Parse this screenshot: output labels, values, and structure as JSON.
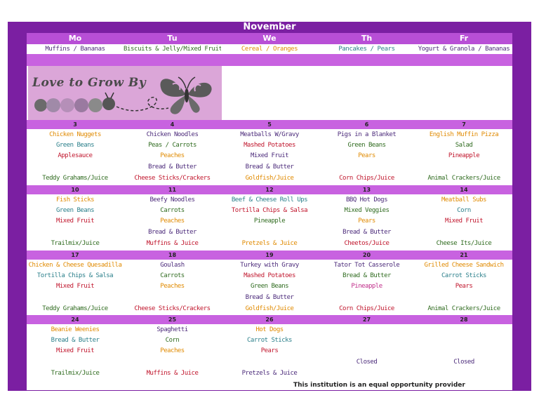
{
  "title": "November",
  "days": [
    "Mo",
    "Tu",
    "We",
    "Th",
    "Fr"
  ],
  "breakfast": [
    "Muffins / Bananas",
    "Biscuits & Jelly/Mixed Fruit",
    "Cereal / Oranges",
    "Pancakes / Pears",
    "Yogurt & Granola / Bananas"
  ],
  "logo_text": "Love to Grow By",
  "colors": {
    "frame": "#7b1fa2",
    "header": "#b84fd6",
    "band": "#c862e0",
    "logo_bg": "#dba6d8"
  },
  "weeks": [
    {
      "days": [
        {
          "num": "3",
          "items": [
            "Chicken Nuggets",
            "Green Beans",
            "Applesauce",
            "",
            "Teddy Grahams/Juice"
          ]
        },
        {
          "num": "4",
          "items": [
            "Chicken Noodles",
            "Peas / Carrots",
            "Peaches",
            "Bread & Butter",
            "Cheese Sticks/Crackers"
          ]
        },
        {
          "num": "5",
          "items": [
            "Meatballs W/Gravy",
            "Mashed Potatoes",
            "Mixed Fruit",
            "Bread & Butter",
            "Goldfish/Juice"
          ]
        },
        {
          "num": "6",
          "items": [
            "Pigs in a Blanket",
            "Green Beans",
            "Pears",
            "",
            "Corn Chips/Juice"
          ]
        },
        {
          "num": "7",
          "items": [
            "English Muffin Pizza",
            "Salad",
            "Pineapple",
            "",
            "Animal Crackers/Juice"
          ]
        }
      ]
    },
    {
      "days": [
        {
          "num": "10",
          "items": [
            "Fish Sticks",
            "Green Beans",
            "Mixed Fruit",
            "",
            "Trailmix/Juice"
          ]
        },
        {
          "num": "11",
          "items": [
            "Beefy Noodles",
            "Carrots",
            "Peaches",
            "Bread & Butter",
            "Muffins & Juice"
          ]
        },
        {
          "num": "12",
          "items": [
            "Beef & Cheese Roll Ups",
            "Tortilla Chips & Salsa",
            "Pineapple",
            "",
            "Pretzels & Juice"
          ]
        },
        {
          "num": "13",
          "items": [
            "BBQ Hot Dogs",
            "Mixed Veggies",
            "Pears",
            "Bread & Butter",
            "Cheetos/Juice"
          ]
        },
        {
          "num": "14",
          "items": [
            "Meatball Subs",
            "Corn",
            "Mixed Fruit",
            "",
            "Cheese Its/Juice"
          ]
        }
      ]
    },
    {
      "days": [
        {
          "num": "17",
          "items": [
            "Chicken & Cheese Quesadilla",
            "Tortilla Chips & Salsa",
            "Mixed Fruit",
            "",
            "Teddy Grahams/Juice"
          ]
        },
        {
          "num": "18",
          "items": [
            "Goulash",
            "Carrots",
            "Peaches",
            "",
            "Cheese Sticks/Crackers"
          ]
        },
        {
          "num": "19",
          "items": [
            "Turkey with Gravy",
            "Mashed Potatoes",
            "Green Beans",
            "Bread & Butter",
            "Goldfish/Juice"
          ]
        },
        {
          "num": "20",
          "items": [
            "Tator Tot Casserole",
            "Bread & Butter",
            "Pineapple",
            "",
            "Corn Chips/Juice"
          ]
        },
        {
          "num": "21",
          "items": [
            "Grilled Cheese Sandwich",
            "Carrot Sticks",
            "Pears",
            "",
            "Animal Crackers/Juice"
          ]
        }
      ]
    },
    {
      "days": [
        {
          "num": "24",
          "items": [
            "Beanie Weenies",
            "Bread & Butter",
            "Mixed Fruit",
            "",
            "Trailmix/Juice"
          ]
        },
        {
          "num": "25",
          "items": [
            "Spaghetti",
            "Corn",
            "Peaches",
            "",
            "Muffins & Juice"
          ]
        },
        {
          "num": "26",
          "items": [
            "Hot Dogs",
            "Carrot Sticks",
            "Pears",
            "",
            "Pretzels & Juice"
          ]
        },
        {
          "num": "27",
          "items": [
            "",
            "",
            "",
            "Closed",
            ""
          ]
        },
        {
          "num": "28",
          "items": [
            "",
            "",
            "",
            "Closed",
            ""
          ]
        }
      ]
    }
  ],
  "footer": "This institution is an equal opportunity provider"
}
